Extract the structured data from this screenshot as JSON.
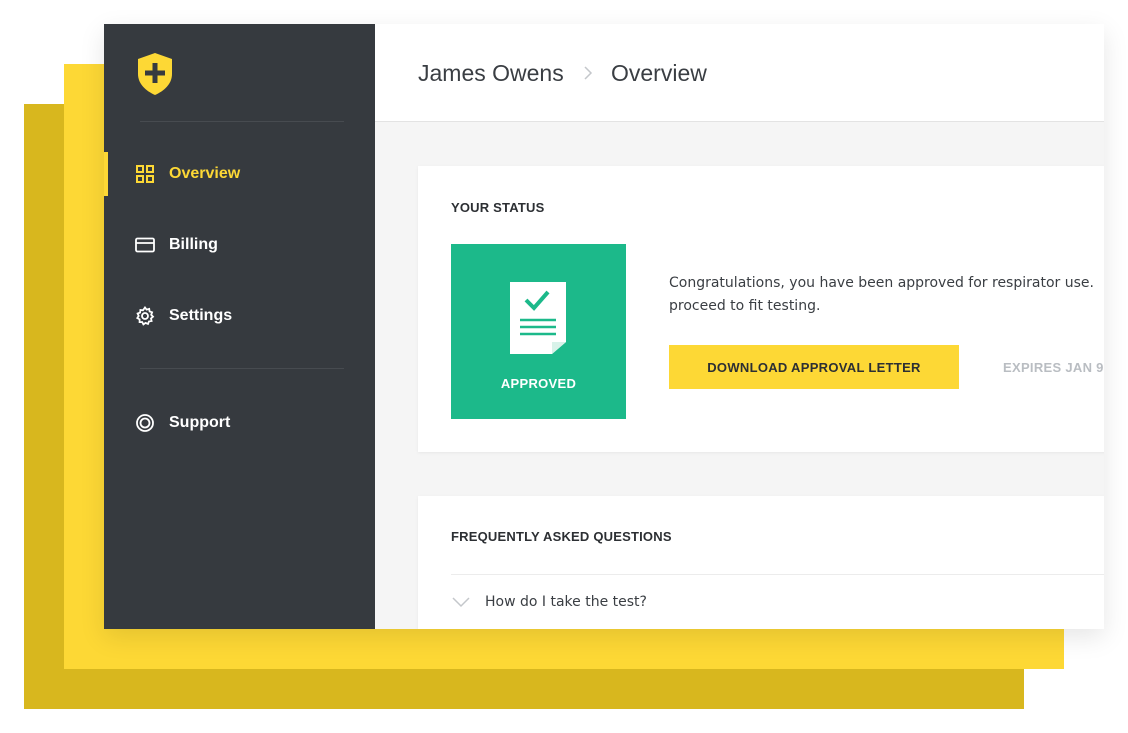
{
  "sidebar": {
    "logo": "shield-plus-icon",
    "items": [
      {
        "label": "Overview",
        "icon": "grid-icon",
        "active": true
      },
      {
        "label": "Billing",
        "icon": "credit-card-icon",
        "active": false
      },
      {
        "label": "Settings",
        "icon": "gear-icon",
        "active": false
      },
      {
        "label": "Support",
        "icon": "lifebuoy-icon",
        "active": false
      }
    ]
  },
  "header": {
    "breadcrumb": [
      "James Owens",
      "Overview"
    ],
    "separator_icon": "chevron-right-icon"
  },
  "status_card": {
    "title": "YOUR STATUS",
    "badge_label": "APPROVED",
    "badge_icon": "document-check-icon",
    "message": "Congratulations, you have been approved for respirator use. proceed to fit testing.",
    "download_label": "DOWNLOAD APPROVAL LETTER",
    "expires": "EXPIRES JAN 9,"
  },
  "faq_card": {
    "title": "FREQUENTLY ASKED QUESTIONS",
    "items": [
      {
        "question": "How do I take the test?",
        "icon": "chevron-down-icon"
      }
    ]
  },
  "colors": {
    "sidebar_bg": "#363a3f",
    "accent_yellow": "#fdd835",
    "approved_green": "#1cb98a",
    "muted_text": "#b9bdc2"
  }
}
